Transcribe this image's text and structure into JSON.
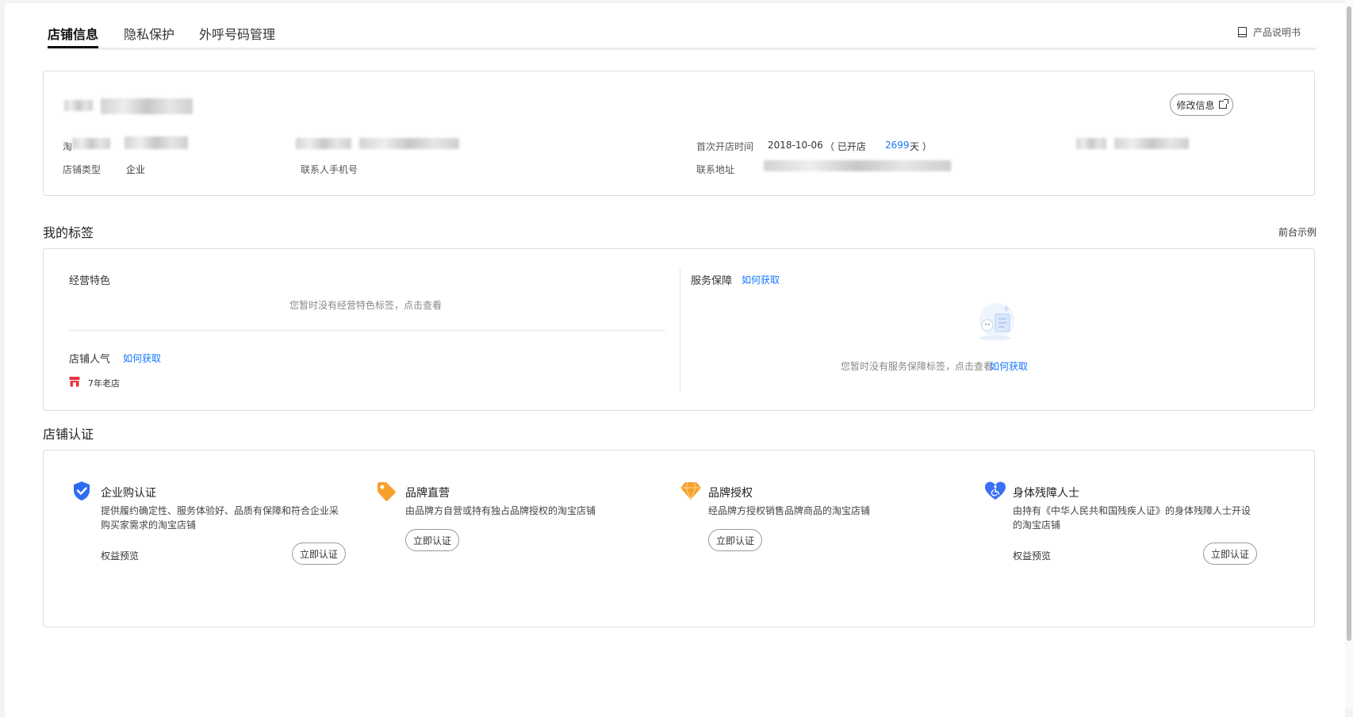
{
  "tabs": [
    {
      "label": "店铺信息",
      "active": true
    },
    {
      "label": "隐私保护",
      "active": false
    },
    {
      "label": "外呼号码管理",
      "active": false
    }
  ],
  "manual_label": "产品说明书",
  "shop_info": {
    "edit_button": "修改信息",
    "taobao_prefix": "淘",
    "shop_type_label": "店铺类型",
    "shop_type_value": "企业",
    "contact_phone_label": "联系人手机号",
    "first_open_label": "首次开店时间",
    "first_open_date": "2018-10-06",
    "opened_prefix": "（ 已开店",
    "opened_days": "2699",
    "opened_suffix": "天 ）",
    "address_label": "联系地址"
  },
  "tags": {
    "title": "我的标签",
    "preview_link": "前台示例",
    "features_title": "经营特色",
    "features_empty": "您暂时没有经营特色标签，点击查看",
    "popularity_title": "店铺人气",
    "how_to_get": "如何获取",
    "badge_label": "7年老店",
    "service_title": "服务保障",
    "service_empty_text": "您暂时没有服务保障标签，点击查看",
    "service_empty_link": "如何获取"
  },
  "certification": {
    "title": "店铺认证",
    "items": [
      {
        "title": "企业购认证",
        "desc": "提供履约确定性、服务体验好、品质有保障和符合企业采购买家需求的淘宝店铺",
        "benefit": "权益预览",
        "button": "立即认证",
        "icon": "shield-check-icon",
        "color": "#2f6cf6"
      },
      {
        "title": "品牌直营",
        "desc": "由品牌方自营或持有独占品牌授权的淘宝店铺",
        "benefit": "",
        "button": "立即认证",
        "icon": "tag-icon",
        "color": "#f7a02c"
      },
      {
        "title": "品牌授权",
        "desc": "经品牌方授权销售品牌商品的淘宝店铺",
        "benefit": "",
        "button": "立即认证",
        "icon": "diamond-icon",
        "color": "#f7a02c"
      },
      {
        "title": "身体残障人士",
        "desc": "由持有《中华人民共和国残疾人证》的身体残障人士开设的淘宝店铺",
        "benefit": "权益预览",
        "button": "立即认证",
        "icon": "accessibility-heart-icon",
        "color": "#3b6ff5"
      }
    ]
  },
  "colors": {
    "accent": "#1677ff",
    "badge_red": "#e8323c",
    "border": "#dcdcdc"
  }
}
